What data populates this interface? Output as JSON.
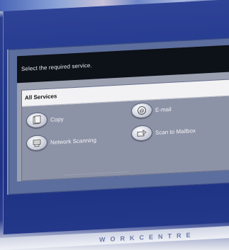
{
  "screen": {
    "prompt": "Select the required service.",
    "services_header": "All Services",
    "services": [
      {
        "label": "Copy",
        "icon": "copy-icon"
      },
      {
        "label": "E-mail",
        "icon": "email-icon"
      },
      {
        "label": "Network Scanning",
        "icon": "network-scanning-icon"
      },
      {
        "label": "Scan to Mailbox",
        "icon": "scan-to-mailbox-icon"
      }
    ]
  },
  "device": {
    "wordmark": "WORKCENTRE"
  },
  "colors": {
    "bezel": "#23398d",
    "prompt_bar": "#0d1118",
    "services_header": "#f2f2f4",
    "services_panel": "#8d93a6"
  }
}
